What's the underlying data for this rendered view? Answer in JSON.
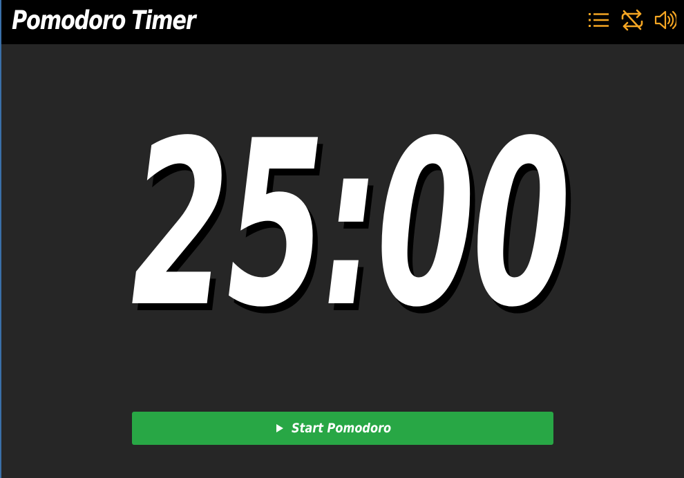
{
  "app": {
    "title": "Pomodoro Timer"
  },
  "header": {
    "icons": [
      {
        "name": "list-icon",
        "color": "#f5a623"
      },
      {
        "name": "repeat-off-icon",
        "color": "#f5a623"
      },
      {
        "name": "volume-icon",
        "color": "#f5a623"
      }
    ]
  },
  "timer": {
    "display": "25:00"
  },
  "controls": {
    "start_label": "Start Pomodoro",
    "start_icon": "play-icon",
    "start_color": "#28a745"
  }
}
